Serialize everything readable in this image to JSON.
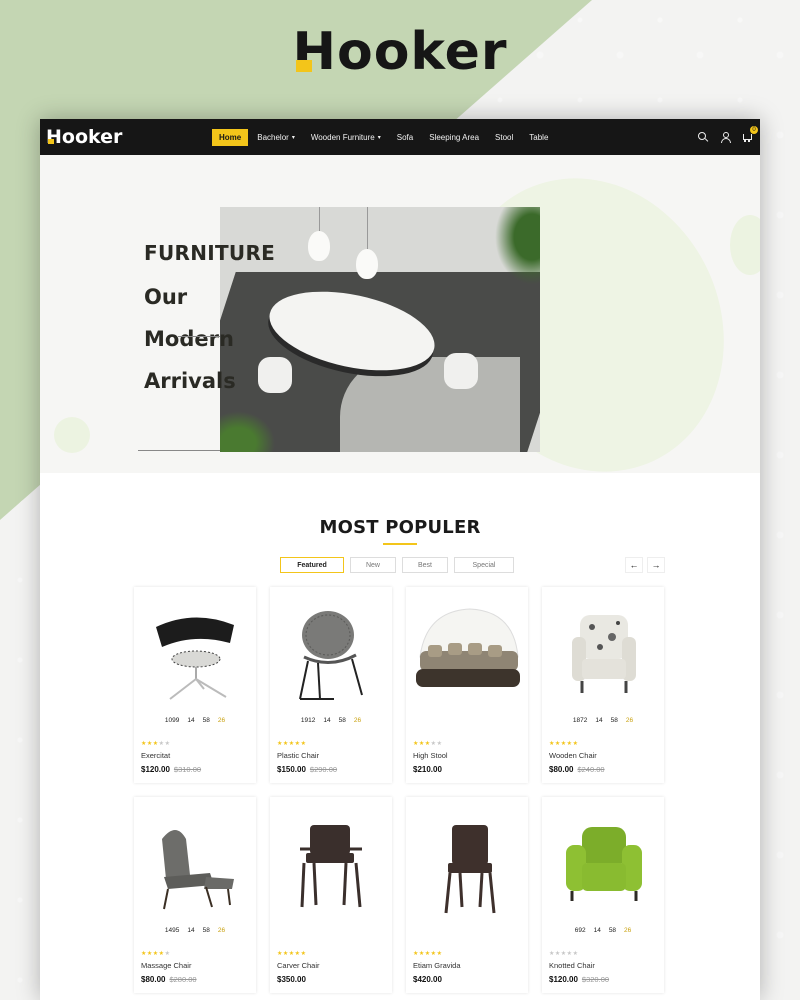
{
  "brand": {
    "logo": "Hooker",
    "nav_logo": "Hooker"
  },
  "colors": {
    "accent": "#f3c51a",
    "nav_bg": "#161616",
    "backdrop_green": "#c4d6b3"
  },
  "nav": {
    "items": [
      {
        "label": "Home",
        "active": true,
        "dropdown": false
      },
      {
        "label": "Bachelor",
        "active": false,
        "dropdown": true
      },
      {
        "label": "Wooden Furniture",
        "active": false,
        "dropdown": true
      },
      {
        "label": "Sofa",
        "active": false,
        "dropdown": false
      },
      {
        "label": "Sleeping Area",
        "active": false,
        "dropdown": false
      },
      {
        "label": "Stool",
        "active": false,
        "dropdown": false
      },
      {
        "label": "Table",
        "active": false,
        "dropdown": false
      }
    ],
    "icons": [
      "search-icon",
      "user-icon",
      "cart-icon"
    ],
    "cart_count": "0"
  },
  "hero": {
    "kicker": "FURNITURE",
    "lines": [
      "Our",
      "Modern",
      "Arrivals"
    ]
  },
  "popular": {
    "title": "MOST POPULER",
    "tabs": [
      "Featured",
      "New",
      "Best",
      "Special"
    ],
    "active_tab": "Featured",
    "arrows": {
      "prev": "←",
      "next": "→"
    },
    "products": [
      {
        "name": "Exercitat",
        "price": "$120.00",
        "old_price": "$310.00",
        "rating": 3,
        "countdown": [
          "1099",
          "14",
          "58",
          "26"
        ],
        "icon": "swivel-chair-icon"
      },
      {
        "name": "Plastic Chair",
        "price": "$150.00",
        "old_price": "$290.00",
        "rating": 5,
        "countdown": [
          "1912",
          "14",
          "58",
          "26"
        ],
        "icon": "mesh-chair-icon"
      },
      {
        "name": "High Stool",
        "price": "$210.00",
        "old_price": "",
        "rating": 3,
        "countdown": [],
        "icon": "daybed-icon"
      },
      {
        "name": "Wooden Chair",
        "price": "$80.00",
        "old_price": "$240.00",
        "rating": 5,
        "countdown": [
          "1872",
          "14",
          "58",
          "26"
        ],
        "icon": "armchair-icon"
      },
      {
        "name": "Massage Chair",
        "price": "$80.00",
        "old_price": "$280.00",
        "rating": 4,
        "countdown": [
          "1495",
          "14",
          "58",
          "26"
        ],
        "icon": "lounge-chair-icon"
      },
      {
        "name": "Carver Chair",
        "price": "$350.00",
        "old_price": "",
        "rating": 5,
        "countdown": [],
        "icon": "dining-chair-icon"
      },
      {
        "name": "Etiam Gravida",
        "price": "$420.00",
        "old_price": "",
        "rating": 5,
        "countdown": [],
        "icon": "side-chair-icon"
      },
      {
        "name": "Knotted Chair",
        "price": "$120.00",
        "old_price": "$320.00",
        "rating": 0,
        "countdown": [
          "692",
          "14",
          "58",
          "26"
        ],
        "icon": "green-armchair-icon"
      }
    ]
  }
}
